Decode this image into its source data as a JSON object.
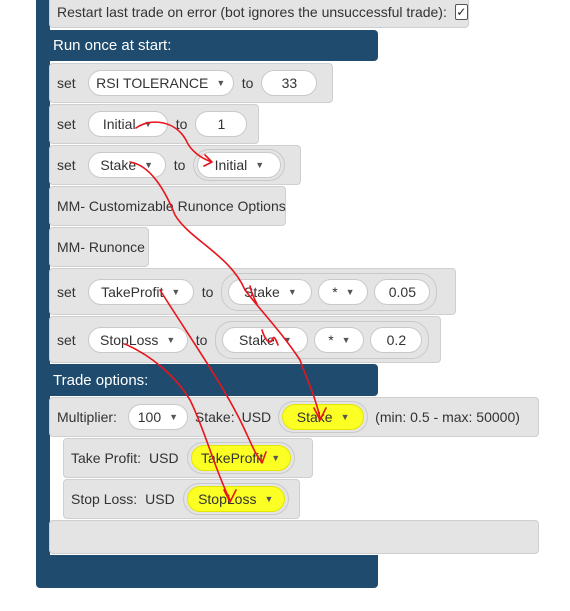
{
  "top_option": {
    "label": "Restart last trade on error (bot ignores the unsuccessful trade):",
    "checked_glyph": "✓"
  },
  "run_once": {
    "header": "Run once at start:",
    "rows": [
      {
        "kw": "set",
        "var": "RSI TOLERANCE",
        "to": "to",
        "value": "33"
      },
      {
        "kw": "set",
        "var": "Initial",
        "to": "to",
        "value": "1"
      },
      {
        "kw": "set",
        "var": "Stake",
        "to": "to",
        "value": "Initial"
      },
      {
        "label": "MM- Customizable Runonce Options"
      },
      {
        "label": "MM- Runonce"
      },
      {
        "kw": "set",
        "var": "TakeProfit",
        "to": "to",
        "operand": "Stake",
        "op": "*",
        "value": "0.05"
      },
      {
        "kw": "set",
        "var": "StopLoss",
        "to": "to",
        "operand": "Stake",
        "op": "*",
        "value": "0.2"
      }
    ]
  },
  "trade": {
    "header": "Trade options:",
    "multiplier_label": "Multiplier:",
    "multiplier_value": "100",
    "stake_label": "Stake:",
    "currency": "USD",
    "stake_value": "Stake",
    "range": "(min: 0.5 - max: 50000)",
    "take_profit_label": "Take Profit:",
    "take_profit_value": "TakeProfit",
    "stop_loss_label": "Stop Loss:",
    "stop_loss_value": "StopLoss"
  },
  "colors": {
    "frame": "#1e4b6e",
    "block": "#e4e4e4",
    "highlight": "#fbff24",
    "annotation": "#e8141c"
  },
  "icons": {
    "dropdown": "caret-down-icon",
    "checkbox": "checkbox-icon"
  }
}
